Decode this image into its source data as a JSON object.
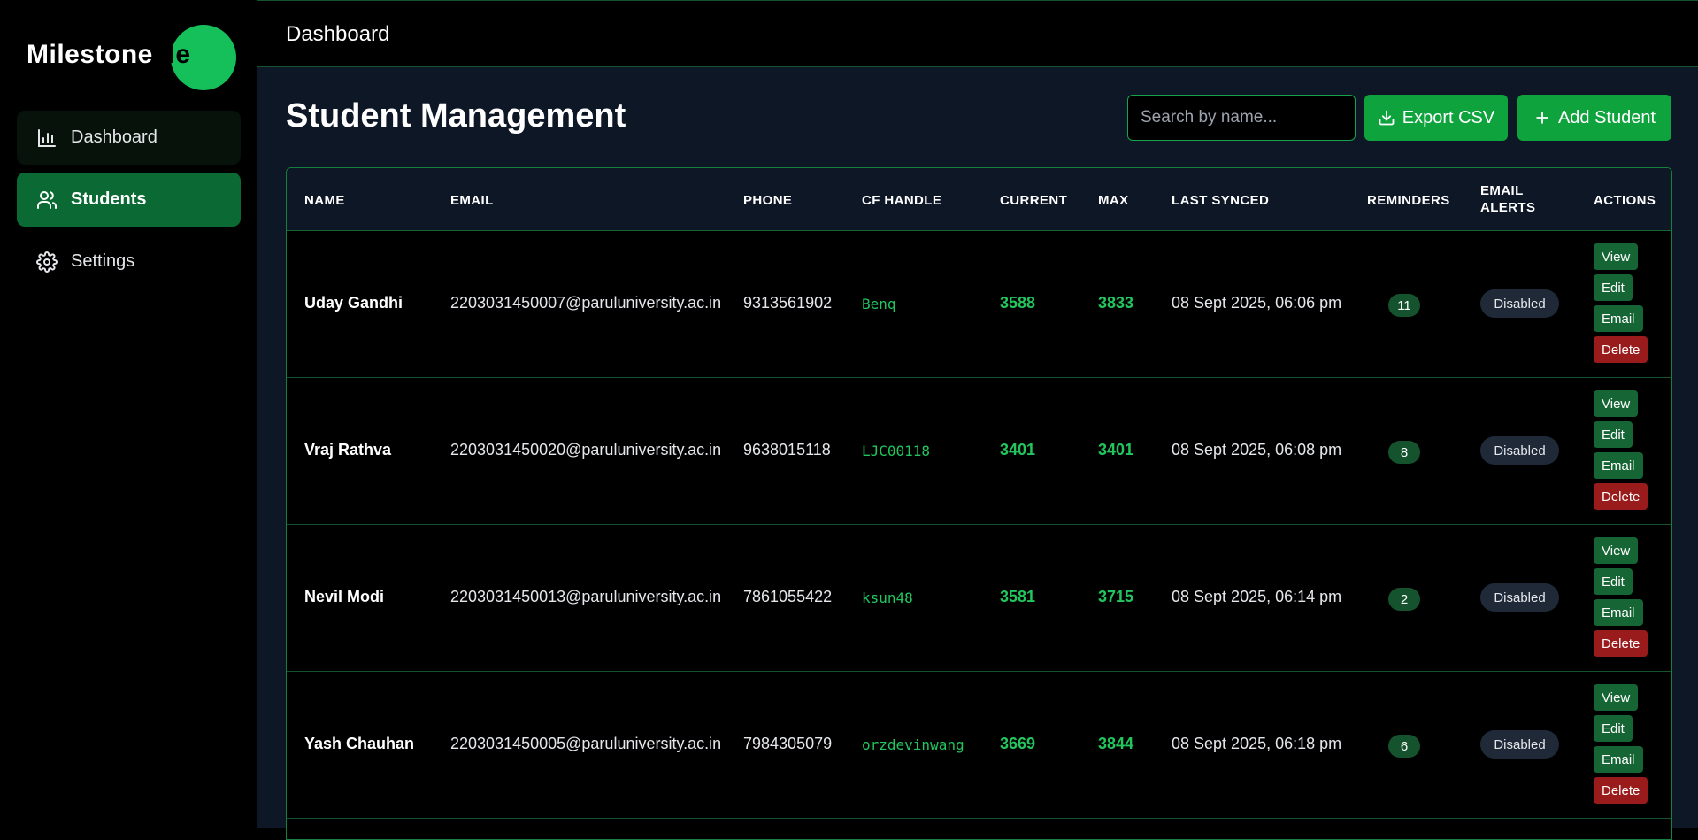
{
  "app": {
    "logo_part1": "Milestone",
    "logo_part2": "Me"
  },
  "sidebar": {
    "items": [
      {
        "label": "Dashboard",
        "icon": "bar-chart-icon"
      },
      {
        "label": "Students",
        "icon": "users-icon",
        "active": true
      },
      {
        "label": "Settings",
        "icon": "gear-icon"
      }
    ]
  },
  "topbar": {
    "title": "Dashboard"
  },
  "page": {
    "title": "Student Management",
    "search_placeholder": "Search by name...",
    "export_label": "Export CSV",
    "add_label": "Add Student"
  },
  "table": {
    "headers": {
      "name": "NAME",
      "email": "EMAIL",
      "phone": "PHONE",
      "cf_handle": "CF HANDLE",
      "current": "CURRENT",
      "max": "MAX",
      "last_synced": "LAST SYNCED",
      "reminders": "REMINDERS",
      "email_alerts_1": "EMAIL",
      "email_alerts_2": "ALERTS",
      "actions": "ACTIONS"
    },
    "action_labels": {
      "view": "View",
      "edit": "Edit",
      "email": "Email",
      "delete": "Delete"
    },
    "rows": [
      {
        "name": "Uday Gandhi",
        "email": "2203031450007@paruluniversity.ac.in",
        "phone": "9313561902",
        "handle": "Benq",
        "current": "3588",
        "max": "3833",
        "synced": "08 Sept 2025, 06:06 pm",
        "reminders": "11",
        "alerts": "Disabled"
      },
      {
        "name": "Vraj Rathva",
        "email": "2203031450020@paruluniversity.ac.in",
        "phone": "9638015118",
        "handle": "LJC00118",
        "current": "3401",
        "max": "3401",
        "synced": "08 Sept 2025, 06:08 pm",
        "reminders": "8",
        "alerts": "Disabled"
      },
      {
        "name": "Nevil Modi",
        "email": "2203031450013@paruluniversity.ac.in",
        "phone": "7861055422",
        "handle": "ksun48",
        "current": "3581",
        "max": "3715",
        "synced": "08 Sept 2025, 06:14 pm",
        "reminders": "2",
        "alerts": "Disabled"
      },
      {
        "name": "Yash Chauhan",
        "email": "2203031450005@paruluniversity.ac.in",
        "phone": "7984305079",
        "handle": "orzdevinwang",
        "current": "3669",
        "max": "3844",
        "synced": "08 Sept 2025, 06:18 pm",
        "reminders": "6",
        "alerts": "Disabled"
      }
    ]
  },
  "colors": {
    "accent": "#0fa33d",
    "sidebar_active": "#0b6a33",
    "delete": "#991b1b",
    "main_bg": "#0e1726"
  }
}
